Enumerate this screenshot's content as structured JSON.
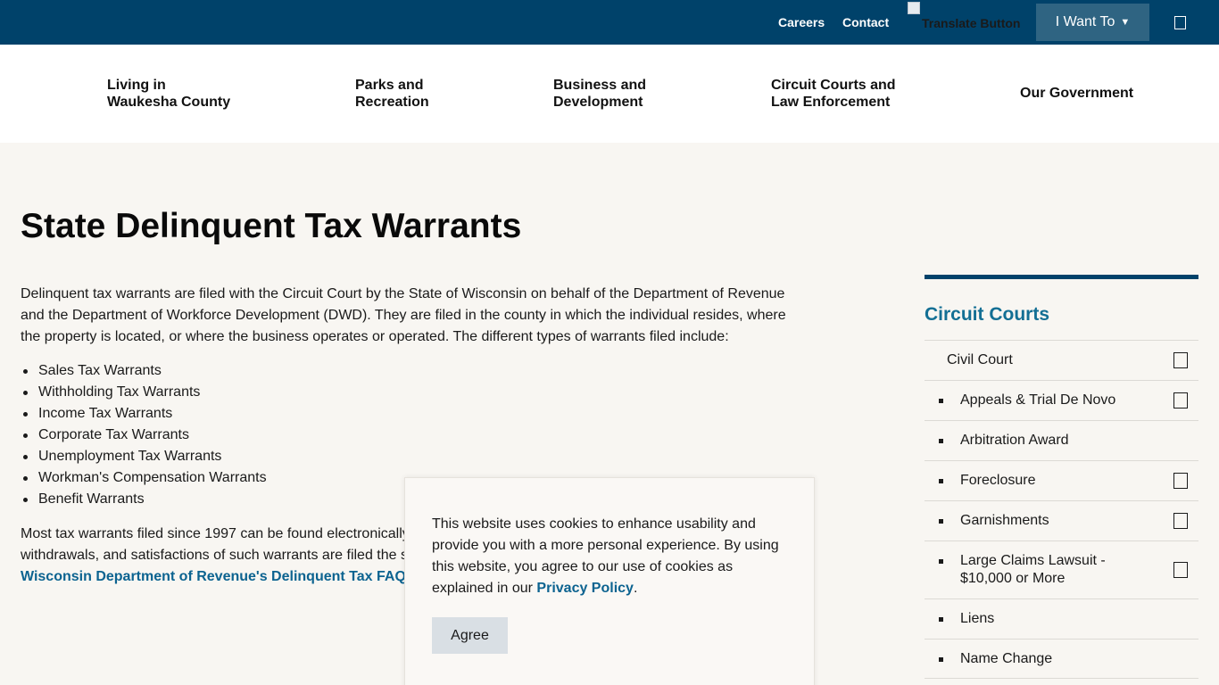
{
  "topbar": {
    "careers": "Careers",
    "contact": "Contact",
    "translate_alt": "Translate Button",
    "i_want_to": "I Want To",
    "i_want_to_caret": "▼"
  },
  "nav": {
    "items": [
      {
        "line1": "Living in",
        "line2": "Waukesha County"
      },
      {
        "line1": "Parks and",
        "line2": "Recreation"
      },
      {
        "line1": "Business and",
        "line2": "Development"
      },
      {
        "line1": "Circuit Courts and",
        "line2": "Law Enforcement"
      },
      {
        "line1": "Our Government",
        "line2": ""
      }
    ]
  },
  "main": {
    "title": "State Delinquent Tax Warrants",
    "intro": "Delinquent tax warrants are filed with the Circuit Court by the State of Wisconsin on behalf of the Department of Revenue and the Department of Workforce Development (DWD). They are filed in the county in which the individual resides, where the property is located, or where the business operates or operated. The different types of warrants filed include:",
    "warrants": [
      "Sales Tax Warrants",
      "Withholding Tax Warrants",
      "Income Tax Warrants",
      "Corporate Tax Warrants",
      "Unemployment Tax Warrants",
      "Workman's Compensation Warrants",
      "Benefit Warrants"
    ],
    "more_line1": "Most tax warrants filed since 1997 can be found electronically",
    "more_line2": "withdrawals, and satisfactions of such warrants are filed the s",
    "faq_link": "Wisconsin Department of Revenue's Delinquent Tax FAQ"
  },
  "sidebar": {
    "title": "Circuit Courts",
    "items": [
      {
        "label": "Civil Court",
        "label2": ""
      },
      {
        "label": "Appeals & Trial De Novo",
        "label2": ""
      },
      {
        "label": "Arbitration Award",
        "label2": ""
      },
      {
        "label": "Foreclosure",
        "label2": ""
      },
      {
        "label": "Garnishments",
        "label2": ""
      },
      {
        "label": "Large Claims Lawsuit -",
        "label2": "$10,000 or More"
      },
      {
        "label": "Liens",
        "label2": ""
      },
      {
        "label": "Name Change",
        "label2": ""
      }
    ]
  },
  "cookie": {
    "text": "This website uses cookies to enhance usability and provide you with a more personal experience. By using this website, you agree to our use of cookies as explained in our ",
    "policy_link": "Privacy Policy",
    "period": ".",
    "agree": "Agree"
  }
}
